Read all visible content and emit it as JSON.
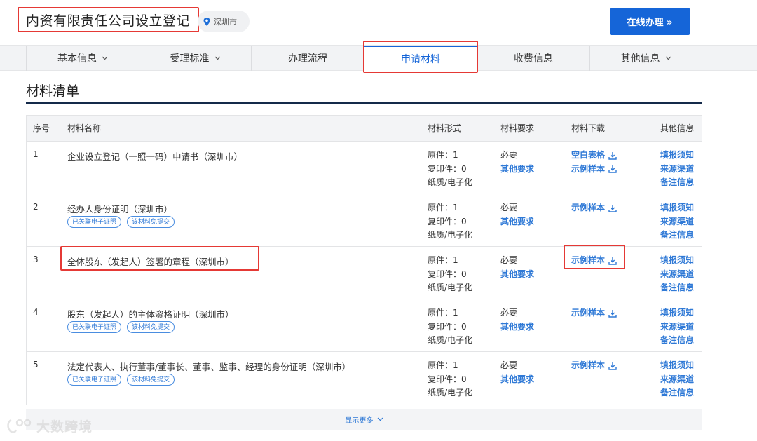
{
  "header": {
    "title": "内资有限责任公司设立登记",
    "location": "深圳市",
    "online_button": "在线办理 »"
  },
  "tabs": [
    {
      "label": "基本信息",
      "has_dropdown": true
    },
    {
      "label": "受理标准",
      "has_dropdown": true
    },
    {
      "label": "办理流程",
      "has_dropdown": false
    },
    {
      "label": "申请材料",
      "has_dropdown": false,
      "active": true
    },
    {
      "label": "收费信息",
      "has_dropdown": false
    },
    {
      "label": "其他信息",
      "has_dropdown": true
    }
  ],
  "section": {
    "title": "材料清单"
  },
  "table": {
    "headers": {
      "seq": "序号",
      "name": "材料名称",
      "form": "材料形式",
      "req": "材料要求",
      "download": "材料下载",
      "other": "其他信息"
    },
    "rows": [
      {
        "seq": "1",
        "name": "企业设立登记（一照一码）申请书（深圳市）",
        "tags": [],
        "form": [
          "原件：1",
          "复印件：0",
          "纸质/电子化"
        ],
        "req": [
          "必要",
          "其他要求"
        ],
        "downloads": [
          "空白表格",
          "示例样本"
        ],
        "other": [
          "填报须知",
          "来源渠道",
          "备注信息"
        ]
      },
      {
        "seq": "2",
        "name": "经办人身份证明（深圳市）",
        "tags": [
          "已关联电子证照",
          "该材料免提交"
        ],
        "form": [
          "原件：1",
          "复印件：0",
          "纸质/电子化"
        ],
        "req": [
          "必要",
          "其他要求"
        ],
        "downloads": [
          "示例样本"
        ],
        "other": [
          "填报须知",
          "来源渠道",
          "备注信息"
        ]
      },
      {
        "seq": "3",
        "name": "全体股东（发起人）签署的章程（深圳市）",
        "tags": [],
        "form": [
          "原件：1",
          "复印件：0",
          "纸质/电子化"
        ],
        "req": [
          "必要",
          "其他要求"
        ],
        "downloads": [
          "示例样本"
        ],
        "other": [
          "填报须知",
          "来源渠道",
          "备注信息"
        ]
      },
      {
        "seq": "4",
        "name": "股东（发起人）的主体资格证明（深圳市）",
        "tags": [
          "已关联电子证照",
          "该材料免提交"
        ],
        "form": [
          "原件：1",
          "复印件：0",
          "纸质/电子化"
        ],
        "req": [
          "必要",
          "其他要求"
        ],
        "downloads": [
          "示例样本"
        ],
        "other": [
          "填报须知",
          "来源渠道",
          "备注信息"
        ]
      },
      {
        "seq": "5",
        "name": "法定代表人、执行董事/董事长、董事、监事、经理的身份证明（深圳市）",
        "tags": [
          "已关联电子证照",
          "该材料免提交"
        ],
        "form": [
          "原件：1",
          "复印件：0",
          "纸质/电子化"
        ],
        "req": [
          "必要",
          "其他要求"
        ],
        "downloads": [
          "示例样本"
        ],
        "other": [
          "填报须知",
          "来源渠道",
          "备注信息"
        ]
      }
    ]
  },
  "show_more": "显示更多",
  "watermark": "大数跨境",
  "colors": {
    "accent": "#1565d8",
    "link": "#2f79d6",
    "highlight": "#e53935",
    "rule": "#142a4a"
  }
}
